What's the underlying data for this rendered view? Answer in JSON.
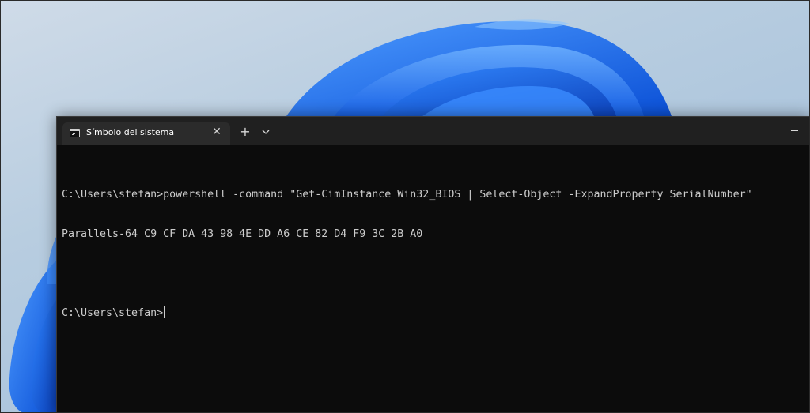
{
  "terminal": {
    "tab_title": "Símbolo del sistema",
    "tab_close_label": "✕",
    "new_tab_label": "+",
    "lines": {
      "command": "C:\\Users\\stefan>powershell -command \"Get-CimInstance Win32_BIOS | Select-Object -ExpandProperty SerialNumber\"",
      "output": "Parallels-64 C9 CF DA 43 98 4E DD A6 CE 82 D4 F9 3C 2B A0",
      "blank": "",
      "prompt": "C:\\Users\\stefan>"
    }
  },
  "colors": {
    "terminal_background": "#0c0c0c",
    "titlebar_background": "#202020",
    "tab_background": "#2b2b2b",
    "text": "#cccccc",
    "wallpaper_accent": "#1a6ff0"
  },
  "icons": {
    "tab": "command-prompt-icon",
    "close": "close-icon",
    "dropdown": "chevron-down-icon",
    "minimize": "minimize-icon"
  }
}
